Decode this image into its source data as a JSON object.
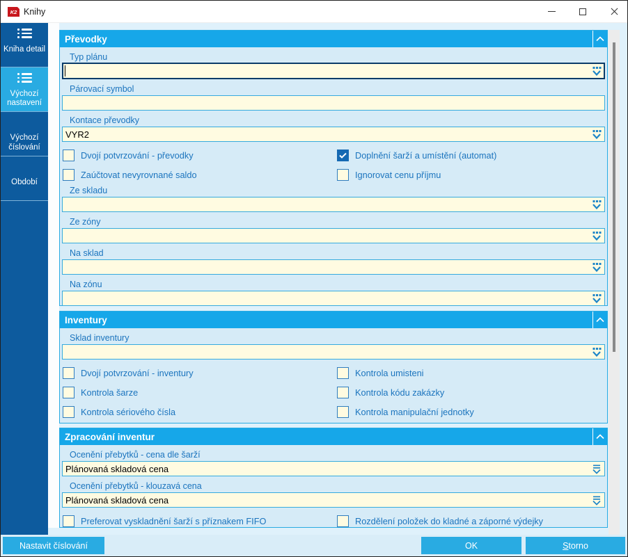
{
  "window": {
    "title": "Knihy",
    "logo_text": "K2"
  },
  "sidebar": {
    "items": [
      {
        "label": "Kniha detail",
        "icon": "detail-list",
        "active": false
      },
      {
        "label": "Výchozí nastavení",
        "icon": "detail-list",
        "active": true
      },
      {
        "label": "Výchozí číslování",
        "icon": "menu",
        "active": false
      },
      {
        "label": "Období",
        "icon": "menu",
        "active": false
      }
    ]
  },
  "prevodky": {
    "title": "Převodky",
    "typ_planu_label": "Typ plánu",
    "typ_planu_value": "",
    "parovaci_symbol_label": "Párovací symbol",
    "parovaci_symbol_value": "",
    "kontace_label": "Kontace převodky",
    "kontace_value": "VYR2",
    "cb_dvoji_label": "Dvojí potvrzování - převodky",
    "cb_doplneni_label": "Doplnění šarží a umístění (automat)",
    "cb_doplneni_checked": true,
    "cb_zauctovat_label": "Zaúčtovat nevyrovnané saldo",
    "cb_ignorovat_label": "Ignorovat cenu příjmu",
    "ze_skladu_label": "Ze skladu",
    "ze_zony_label": "Ze zóny",
    "na_sklad_label": "Na sklad",
    "na_zonu_label": "Na zónu"
  },
  "inventury": {
    "title": "Inventury",
    "sklad_label": "Sklad inventury",
    "cb_dvoji_label": "Dvojí potvrzování - inventury",
    "cb_umisteni_label": "Kontrola umisteni",
    "cb_sarze_label": "Kontrola šarze",
    "cb_kodu_label": "Kontrola kódu zakázky",
    "cb_serioveho_label": "Kontrola sériového čísla",
    "cb_manipulacni_label": "Kontrola manipulační jednotky"
  },
  "zpracovani": {
    "title": "Zpracování inventur",
    "oceneni_sarzi_label": "Ocenění přebytků - cena dle šarží",
    "oceneni_sarzi_value": "Plánovaná skladová cena",
    "oceneni_klouzava_label": "Ocenění přebytků - klouzavá cena",
    "oceneni_klouzava_value": "Plánovaná skladová cena",
    "cb_fifo_label": "Preferovat vyskladnění šarží s příznakem FIFO",
    "cb_rozdeleni_label": "Rozdělení položek do kladné a záporné výdejky"
  },
  "footer": {
    "nastavit_label": "Nastavit číslování",
    "ok_label": "OK",
    "storno_initial": "S",
    "storno_rest": "torno"
  },
  "colors": {
    "sidebar_blue": "#0d5b9e",
    "accent_blue": "#29abe2",
    "section_header_blue": "#16a7e9",
    "section_body_blue": "#d6ebf7",
    "label_blue": "#1b74be",
    "input_cream": "#fffbe1",
    "checked_blue": "#1569b3",
    "logo_red": "#c8171d",
    "focus_border": "#0a3b69"
  }
}
